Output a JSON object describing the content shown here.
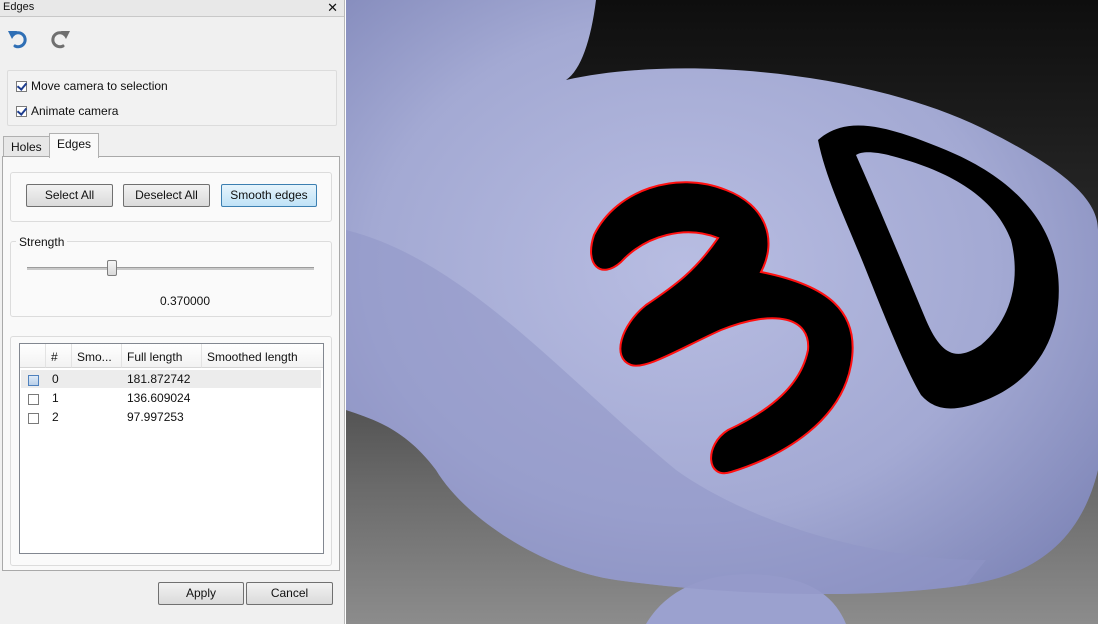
{
  "window": {
    "title": "Edges"
  },
  "toolbar": {
    "undo_icon": "undo-icon",
    "redo_icon": "redo-icon"
  },
  "camera": {
    "move_camera_label": "Move camera to selection",
    "move_camera_checked": true,
    "animate_camera_label": "Animate camera",
    "animate_camera_checked": true
  },
  "tabs": [
    {
      "label": "Holes",
      "active": false
    },
    {
      "label": "Edges",
      "active": true
    }
  ],
  "edges_actions": {
    "select_all": "Select All",
    "deselect_all": "Deselect All",
    "smooth_edges": "Smooth edges"
  },
  "strength": {
    "label": "Strength",
    "value_text": "0.370000",
    "value": 0.37
  },
  "table": {
    "columns": [
      "#",
      "Smo...",
      "Full length",
      "Smoothed length"
    ],
    "rows": [
      {
        "index": "0",
        "smoothed": "",
        "full_length": "181.872742",
        "smoothed_length": "",
        "checked": false,
        "selected": true
      },
      {
        "index": "1",
        "smoothed": "",
        "full_length": "136.609024",
        "smoothed_length": "",
        "checked": false,
        "selected": false
      },
      {
        "index": "2",
        "smoothed": "",
        "full_length": "97.997253",
        "smoothed_length": "",
        "checked": false,
        "selected": false
      }
    ]
  },
  "footer": {
    "apply": "Apply",
    "cancel": "Cancel"
  },
  "colors": {
    "mesh": "#a8aed6",
    "edge_outline": "#ff1010",
    "hole_fill": "#000000",
    "accent": "#3c7fb1"
  }
}
